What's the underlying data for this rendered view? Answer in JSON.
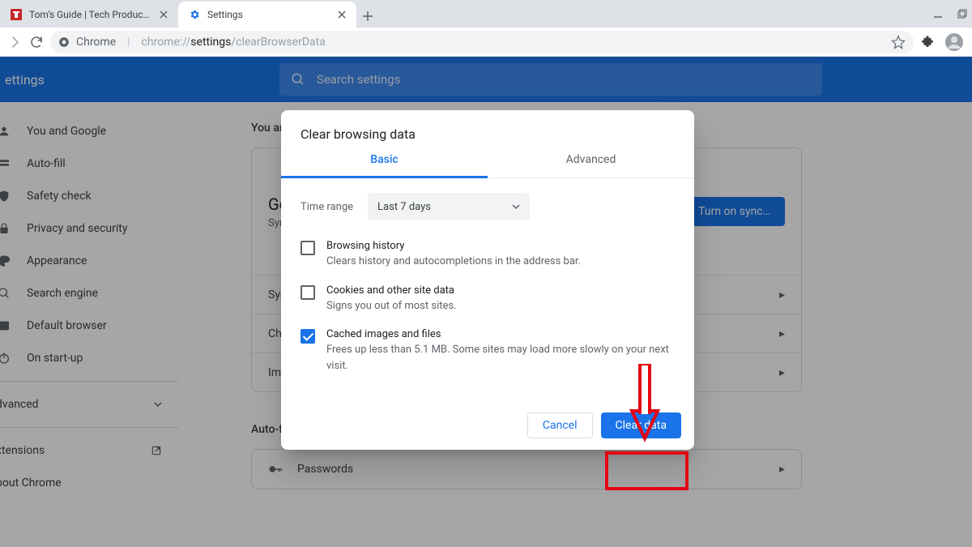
{
  "tabs": {
    "inactive": {
      "title": "Tom's Guide | Tech Product Revie"
    },
    "active": {
      "title": "Settings"
    }
  },
  "omnibox": {
    "scheme_label": "Chrome",
    "url_prefix": "chrome://",
    "url_mid": "settings",
    "url_suffix": "/clearBrowserData"
  },
  "settings": {
    "title": "ettings",
    "search_placeholder": "Search settings",
    "sidebar": {
      "items": [
        "You and Google",
        "Auto-fill",
        "Safety check",
        "Privacy and security",
        "Appearance",
        "Search engine",
        "Default browser",
        "On start-up"
      ],
      "advanced": "dvanced",
      "extensions": "xtensions",
      "about": "bout Chrome"
    },
    "main": {
      "section1": "You an",
      "sync_card": {
        "title_fragment": "Ge",
        "subtitle_fragment": "Syn",
        "button": "Turn on sync…"
      },
      "rows": [
        "Syn",
        "Chr",
        "Imp"
      ],
      "autofill_heading": "Auto-f",
      "passwords_row": "Passwords"
    }
  },
  "dialog": {
    "title": "Clear browsing data",
    "tabs": {
      "basic": "Basic",
      "advanced": "Advanced"
    },
    "time_label": "Time range",
    "time_value": "Last 7 days",
    "opts": [
      {
        "title": "Browsing history",
        "desc": "Clears history and autocompletions in the address bar.",
        "checked": false
      },
      {
        "title": "Cookies and other site data",
        "desc": "Signs you out of most sites.",
        "checked": false
      },
      {
        "title": "Cached images and files",
        "desc": "Frees up less than 5.1 MB. Some sites may load more slowly on your next visit.",
        "checked": true
      }
    ],
    "cancel": "Cancel",
    "clear": "Clear data"
  }
}
